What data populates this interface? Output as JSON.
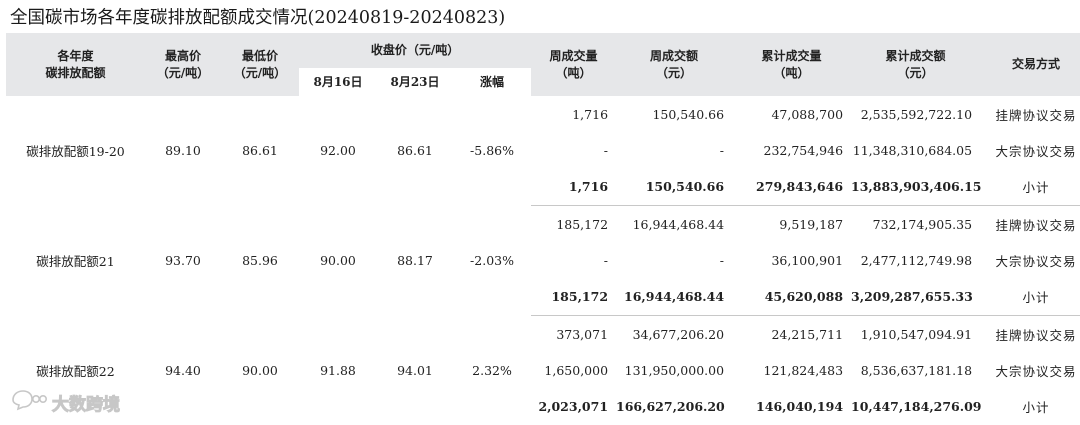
{
  "title": "全国碳市场各年度碳排放配额成交情况(20240819-20240823)",
  "headers": {
    "allowance": [
      "各年度",
      "碳排放配额"
    ],
    "high_price": [
      "最高价",
      "（元/吨）"
    ],
    "low_price": [
      "最低价",
      "（元/吨）"
    ],
    "close_price": "收盘价（元/吨）",
    "close_aug16": "8月16日",
    "close_aug23": "8月23日",
    "change": "涨幅",
    "week_volume": [
      "周成交量",
      "（吨）"
    ],
    "week_amount": [
      "周成交额",
      "（元）"
    ],
    "cum_volume": [
      "累计成交量",
      "（吨）"
    ],
    "cum_amount": [
      "累计成交额",
      "（元）"
    ],
    "method": "交易方式"
  },
  "groups": [
    {
      "name": "碳排放配额19-20",
      "high": "89.10",
      "low": "86.61",
      "close_aug16": "92.00",
      "close_aug23": "86.61",
      "change": "-5.86%",
      "rows": [
        {
          "week_volume": "1,716",
          "week_amount": "150,540.66",
          "cum_volume": "47,088,700",
          "cum_amount": "2,535,592,722.10",
          "method": "挂牌协议交易"
        },
        {
          "week_volume": "-",
          "week_amount": "-",
          "cum_volume": "232,754,946",
          "cum_amount": "11,348,310,684.05",
          "method": "大宗协议交易"
        },
        {
          "week_volume": "1,716",
          "week_amount": "150,540.66",
          "cum_volume": "279,843,646",
          "cum_amount": "13,883,903,406.15",
          "method": "小计"
        }
      ]
    },
    {
      "name": "碳排放配额21",
      "high": "93.70",
      "low": "85.96",
      "close_aug16": "90.00",
      "close_aug23": "88.17",
      "change": "-2.03%",
      "rows": [
        {
          "week_volume": "185,172",
          "week_amount": "16,944,468.44",
          "cum_volume": "9,519,187",
          "cum_amount": "732,174,905.35",
          "method": "挂牌协议交易"
        },
        {
          "week_volume": "-",
          "week_amount": "-",
          "cum_volume": "36,100,901",
          "cum_amount": "2,477,112,749.98",
          "method": "大宗协议交易"
        },
        {
          "week_volume": "185,172",
          "week_amount": "16,944,468.44",
          "cum_volume": "45,620,088",
          "cum_amount": "3,209,287,655.33",
          "method": "小计"
        }
      ]
    },
    {
      "name": "碳排放配额22",
      "high": "94.40",
      "low": "90.00",
      "close_aug16": "91.88",
      "close_aug23": "94.01",
      "change": "2.32%",
      "rows": [
        {
          "week_volume": "373,071",
          "week_amount": "34,677,206.20",
          "cum_volume": "24,215,711",
          "cum_amount": "1,910,547,094.91",
          "method": "挂牌协议交易"
        },
        {
          "week_volume": "1,650,000",
          "week_amount": "131,950,000.00",
          "cum_volume": "121,824,483",
          "cum_amount": "8,536,637,181.18",
          "method": "大宗协议交易"
        },
        {
          "week_volume": "2,023,071",
          "week_amount": "166,627,206.20",
          "cum_volume": "146,040,194",
          "cum_amount": "10,447,184,276.09",
          "method": "小计"
        }
      ]
    }
  ],
  "watermark": {
    "text": "大数跨境",
    "icon": "chat-bubble-logo-icon"
  }
}
